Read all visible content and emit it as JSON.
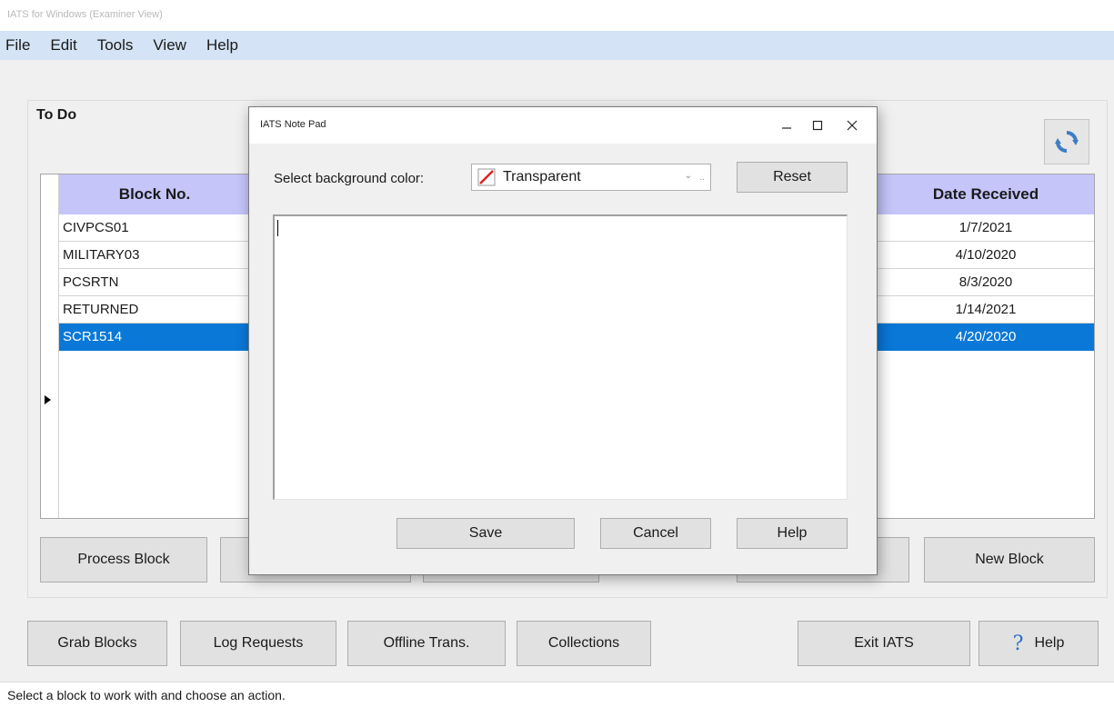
{
  "app": {
    "title": "IATS for Windows (Examiner View)"
  },
  "menu": {
    "items": [
      "File",
      "Edit",
      "Tools",
      "View",
      "Help"
    ]
  },
  "todo": {
    "label": "To Do",
    "refresh_icon": "refresh-icon",
    "columns": {
      "block_no": "Block No.",
      "date_received": "Date Received"
    },
    "rows": [
      {
        "block": "CIVPCS01",
        "date": "1/7/2021"
      },
      {
        "block": "MILITARY03",
        "date": "4/10/2020"
      },
      {
        "block": "PCSRTN",
        "date": "8/3/2020"
      },
      {
        "block": "RETURNED",
        "date": "1/14/2021"
      },
      {
        "block": "SCR1514",
        "date": "4/20/2020",
        "selected": true
      }
    ],
    "buttons": {
      "process_block": "Process Block",
      "new_block": "New Block"
    }
  },
  "bottom_buttons": {
    "grab_blocks": "Grab Blocks",
    "log_requests": "Log Requests",
    "offline_trans": "Offline Trans.",
    "collections": "Collections",
    "exit_iats": "Exit IATS",
    "help": "Help"
  },
  "status": {
    "text": "Select a block to work with and choose an action."
  },
  "dialog": {
    "title": "IATS Note Pad",
    "bg_color_label": "Select background color:",
    "bg_color_value": "Transparent",
    "reset_label": "Reset",
    "notepad_text": "",
    "save_label": "Save",
    "cancel_label": "Cancel",
    "help_label": "Help"
  },
  "colors": {
    "menubar": "#d4e3f5",
    "grid_header": "#c5c5fa",
    "selection": "#0a78d7",
    "refresh_icon": "#3d7dc4"
  }
}
